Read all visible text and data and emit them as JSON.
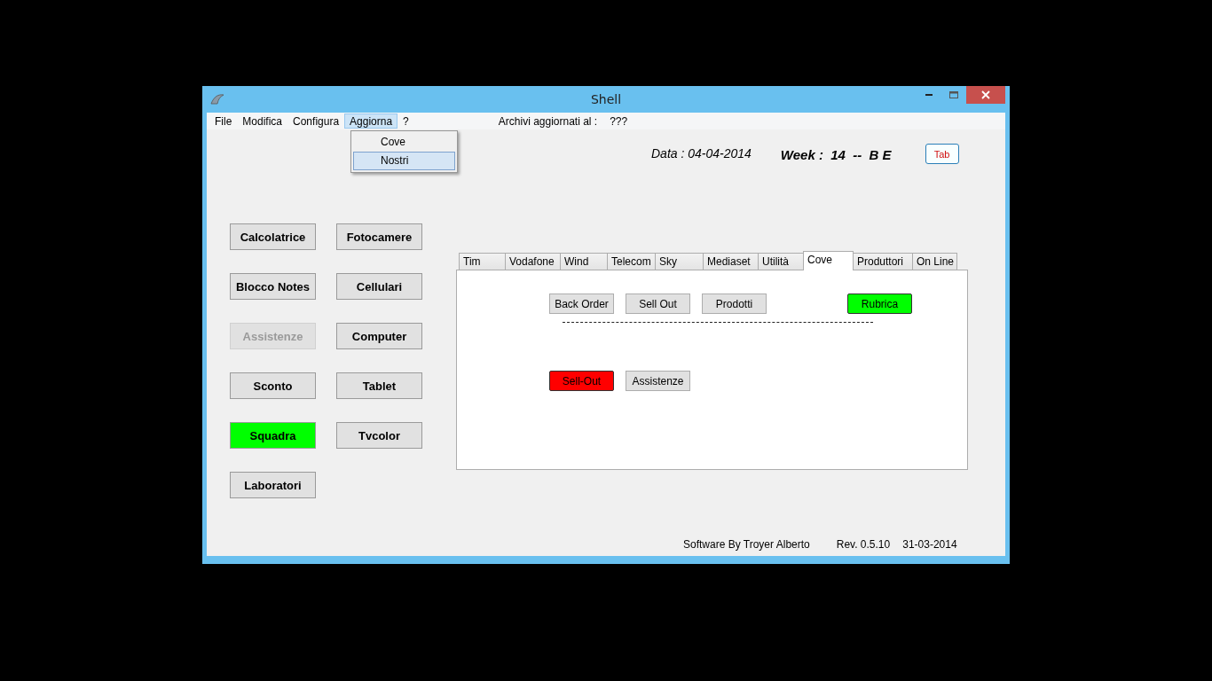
{
  "window": {
    "title": "Shell"
  },
  "menu": [
    {
      "label": "File",
      "selected": false
    },
    {
      "label": "Modifica",
      "selected": false
    },
    {
      "label": "Configura",
      "selected": false
    },
    {
      "label": "Aggiorna",
      "selected": true
    },
    {
      "label": "?",
      "selected": false
    }
  ],
  "archive": {
    "label": "Archivi aggiornati al :",
    "value": "???"
  },
  "dropdown": [
    {
      "label": "Cove",
      "selected": false
    },
    {
      "label": "Nostri",
      "selected": true
    }
  ],
  "header": {
    "date": "Data : 04-04-2014",
    "week": "Week :  14  --  B E",
    "tab_button": "Tab"
  },
  "left_buttons": [
    {
      "label": "Calcolatrice",
      "disabled": false,
      "color": "#e1e1e1"
    },
    {
      "label": "Fotocamere",
      "disabled": false,
      "color": "#e1e1e1"
    },
    {
      "label": "Blocco Notes",
      "disabled": false,
      "color": "#e1e1e1"
    },
    {
      "label": "Cellulari",
      "disabled": false,
      "color": "#e1e1e1"
    },
    {
      "label": "Assistenze",
      "disabled": true,
      "color": "#e1e1e1"
    },
    {
      "label": "Computer",
      "disabled": false,
      "color": "#e1e1e1"
    },
    {
      "label": "Sconto",
      "disabled": false,
      "color": "#e1e1e1"
    },
    {
      "label": "Tablet",
      "disabled": false,
      "color": "#e1e1e1"
    },
    {
      "label": "Squadra",
      "disabled": false,
      "color": "#00ff00"
    },
    {
      "label": "Tvcolor",
      "disabled": false,
      "color": "#e1e1e1"
    },
    {
      "label": "Laboratori",
      "disabled": false,
      "color": "#e1e1e1"
    }
  ],
  "tabs": [
    {
      "label": "Tim",
      "selected": false
    },
    {
      "label": "Vodafone",
      "selected": false
    },
    {
      "label": "Wind",
      "selected": false
    },
    {
      "label": "Telecom",
      "selected": false
    },
    {
      "label": "Sky",
      "selected": false
    },
    {
      "label": "Mediaset",
      "selected": false
    },
    {
      "label": "Utilità",
      "selected": false
    },
    {
      "label": "Cove",
      "selected": true
    },
    {
      "label": "Produttori",
      "selected": false
    },
    {
      "label": "On Line",
      "selected": false
    }
  ],
  "panel": {
    "row_1": [
      {
        "label": "Back Order",
        "color": "#e1e1e1"
      },
      {
        "label": "Sell Out",
        "color": "#e1e1e1"
      },
      {
        "label": "Prodotti",
        "color": "#e1e1e1"
      },
      {
        "label": "Rubrica",
        "color": "#00ff00"
      }
    ],
    "row_2": [
      {
        "label": "Sell-Out",
        "color": "#ff0000"
      },
      {
        "label": "Assistenze",
        "color": "#e1e1e1"
      }
    ]
  },
  "footer": {
    "author": "Software By Troyer Alberto",
    "revision": "Rev. 0.5.10",
    "date": "31-03-2014"
  }
}
